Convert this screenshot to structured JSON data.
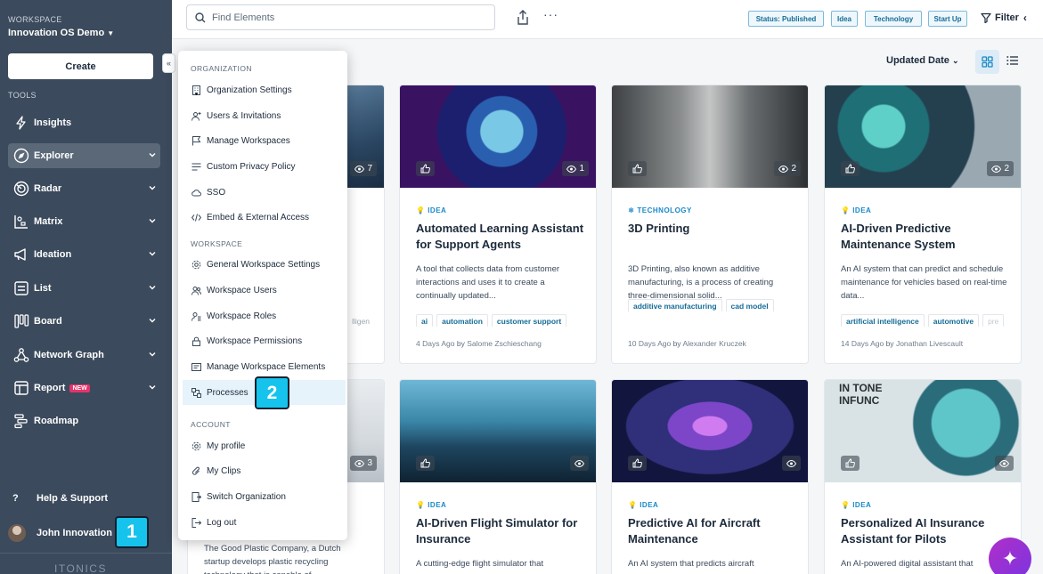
{
  "sidebar": {
    "workspace_label": "WORKSPACE",
    "workspace_name": "Innovation OS Demo",
    "create_label": "Create",
    "tools_label": "TOOLS",
    "items": [
      {
        "label": "Insights"
      },
      {
        "label": "Explorer"
      },
      {
        "label": "Radar"
      },
      {
        "label": "Matrix"
      },
      {
        "label": "Ideation"
      },
      {
        "label": "List"
      },
      {
        "label": "Board"
      },
      {
        "label": "Network Graph"
      },
      {
        "label": "Report",
        "badge": "NEW"
      },
      {
        "label": "Roadmap"
      }
    ],
    "help_label": "Help & Support",
    "user_name": "John Innovation",
    "logo_text": "ITONICS"
  },
  "topbar": {
    "search_placeholder": "Find Elements",
    "chips": [
      "Status: Published",
      "Idea",
      "Technology",
      "Start Up"
    ],
    "filter_label": "Filter"
  },
  "toolbar": {
    "sort_label": "Updated Date"
  },
  "dropdown": {
    "sections": [
      {
        "label": "ORGANIZATION",
        "items": [
          "Organization Settings",
          "Users & Invitations",
          "Manage Workspaces",
          "Custom Privacy Policy",
          "SSO",
          "Embed & External Access"
        ]
      },
      {
        "label": "WORKSPACE",
        "items": [
          "General Workspace Settings",
          "Workspace Users",
          "Workspace Roles",
          "Workspace Permissions",
          "Manage Workspace Elements",
          "Processes"
        ]
      },
      {
        "label": "ACCOUNT",
        "items": [
          "My profile",
          "My Clips",
          "Switch Organization",
          "Log out"
        ]
      }
    ]
  },
  "cards": [
    {
      "type": "IDEA",
      "title": "Automated Learning Assistant for Support Agents",
      "desc": "A tool that collects data from customer interactions and uses it to create a continually updated...",
      "tags": [
        "ai",
        "automation",
        "customer support"
      ],
      "time": "4 Days Ago",
      "by": "by",
      "author": "Salome Zschieschang",
      "views": "1"
    },
    {
      "type": "TECHNOLOGY",
      "title": "3D Printing",
      "desc": "3D Printing, also known as additive manufacturing, is a process of creating three-dimensional solid...",
      "tags": [
        "additive manufacturing",
        "cad model"
      ],
      "time": "10 Days Ago",
      "by": "by",
      "author": "Alexander Kruczek",
      "views": "2"
    },
    {
      "type": "IDEA",
      "title": "AI-Driven Predictive Maintenance System",
      "desc": "An AI system that can predict and schedule maintenance for vehicles based on real-time data...",
      "tags": [
        "artificial intelligence",
        "automotive",
        "pre"
      ],
      "time": "14 Days Ago",
      "by": "by",
      "author": "Jonathan Livescault",
      "views": "2"
    },
    {
      "type": "IDEA",
      "title": "AI-Driven Flight Simulator for Insurance",
      "desc": "A cutting-edge flight simulator that",
      "views": ""
    },
    {
      "type": "IDEA",
      "title": "Predictive AI for Aircraft Maintenance",
      "desc": "An AI system that predicts aircraft",
      "views": ""
    },
    {
      "type": "IDEA",
      "title": "Personalized AI Insurance Assistant for Pilots",
      "desc": "An AI-powered digital assistant that",
      "views": ""
    }
  ],
  "partial_cards": {
    "top_views": "7",
    "top_tag_fragment": "lligen",
    "bottom_views": "3",
    "bottom_desc": "The Good Plastic Company, a Dutch startup develops plastic recycling technology that is capable of"
  },
  "image_text": {
    "poster_line1": "IN TONE",
    "poster_line2": "INFUNC"
  },
  "markers": [
    "1",
    "2"
  ],
  "colors": {
    "sidebar": "#3b4a5c",
    "accent": "#1889c7",
    "marker": "#15c3ec",
    "badge": "#e5336b"
  }
}
